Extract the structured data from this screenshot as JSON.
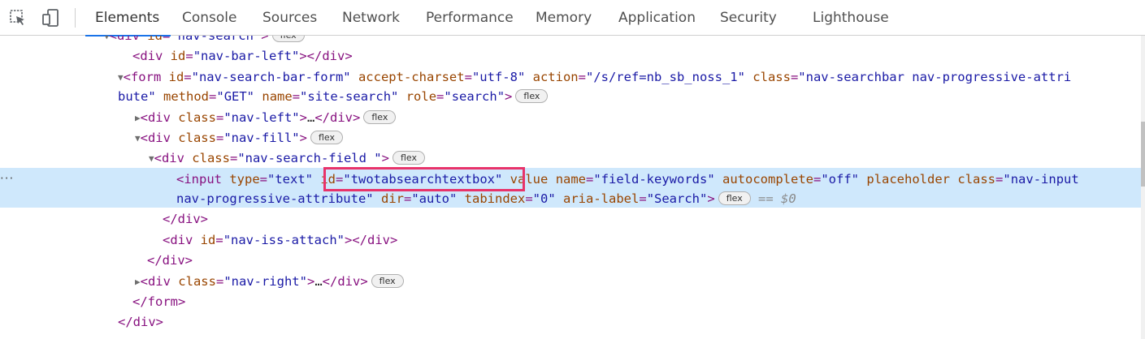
{
  "toolbar": {
    "inspect_icon": "inspect-element-icon",
    "device_icon": "device-toolbar-icon",
    "tabs": [
      {
        "label": "Elements",
        "active": true
      },
      {
        "label": "Console"
      },
      {
        "label": "Sources"
      },
      {
        "label": "Network"
      },
      {
        "label": "Performance"
      },
      {
        "label": "Memory"
      },
      {
        "label": "Application"
      },
      {
        "label": "Security"
      },
      {
        "label": "Lighthouse"
      }
    ]
  },
  "colors": {
    "tag": "#881280",
    "attr_name": "#994500",
    "attr_value": "#1a1aa6",
    "selection": "#cfe8fc",
    "highlight": "#e8336a",
    "active_tab": "#1a73e8"
  },
  "tree": {
    "badge": "flex",
    "dollar_ref": "== $0",
    "ellipsis": "…",
    "row_dots": "···",
    "line0": {
      "prefix": "<div ",
      "attr": "id",
      "val": "\"nav-search\"",
      "suffix": ">"
    },
    "line1": {
      "open": "<div ",
      "attr": "id",
      "val": "\"nav-bar-left\"",
      "close": "></div>"
    },
    "line2": {
      "a1": "id",
      "v1": "\"nav-search-bar-form\"",
      "a2": "accept-charset",
      "v2": "\"utf-8\"",
      "a3": "action",
      "v3": "\"/s/ref=nb_sb_noss_1\"",
      "a4": "class",
      "v4": "\"nav-searchbar nav-progressive-attri"
    },
    "line3": {
      "v4cont": "bute\"",
      "a5": "method",
      "v5": "\"GET\"",
      "a6": "name",
      "v6": "\"site-search\"",
      "a7": "role",
      "v7": "\"search\""
    },
    "line4": {
      "attr": "class",
      "val": "\"nav-left\""
    },
    "line5": {
      "attr": "class",
      "val": "\"nav-fill\""
    },
    "line6": {
      "attr": "class",
      "val": "\"nav-search-field \""
    },
    "line7": {
      "a1": "type",
      "v1": "\"text\"",
      "a2": "id",
      "v2": "\"twotabsearchtextbox\"",
      "a3": "value",
      "a4": "name",
      "v4": "\"field-keywords\"",
      "a5": "autocomplete",
      "v5": "\"off\"",
      "a6": "placeholder",
      "a7": "class",
      "v7": "\"nav-input"
    },
    "line8": {
      "v7cont": "nav-progressive-attribute\"",
      "a8": "dir",
      "v8": "\"auto\"",
      "a9": "tabindex",
      "v9": "\"0\"",
      "a10": "aria-label",
      "v10": "\"Search\""
    },
    "line10": {
      "attr": "id",
      "val": "\"nav-iss-attach\""
    },
    "line12": {
      "attr": "class",
      "val": "\"nav-right\""
    }
  }
}
